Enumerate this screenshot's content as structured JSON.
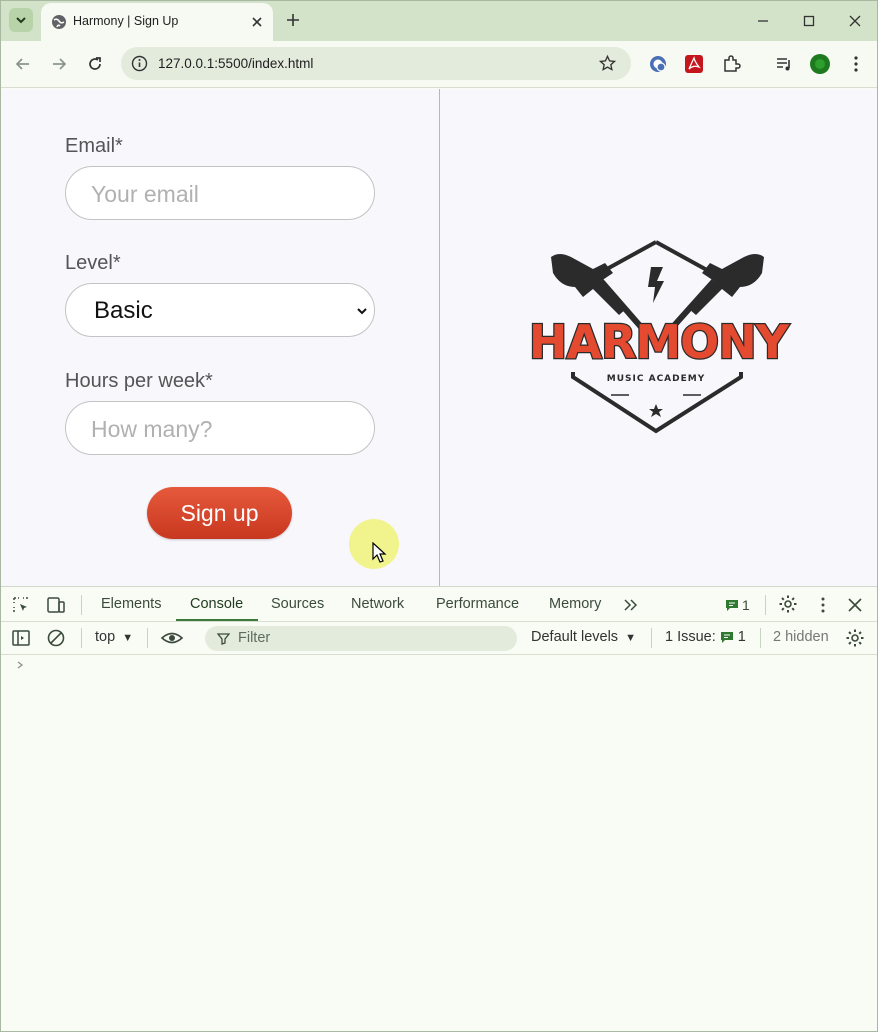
{
  "browser": {
    "tab": {
      "title": "Harmony | Sign Up"
    },
    "address_bar": {
      "url": "127.0.0.1:5500/index.html"
    }
  },
  "page": {
    "form": {
      "email": {
        "label": "Email*",
        "placeholder": "Your email"
      },
      "level": {
        "label": "Level*",
        "selected": "Basic"
      },
      "hours": {
        "label": "Hours per week*",
        "placeholder": "How many?"
      },
      "submit_label": "Sign up"
    },
    "logo": {
      "title": "HARMONY",
      "subtitle": "MUSIC ACADEMY"
    }
  },
  "devtools": {
    "tabs": [
      "Elements",
      "Console",
      "Sources",
      "Network",
      "Performance",
      "Memory"
    ],
    "active_tab": "Console",
    "message_count": "1",
    "console": {
      "context": "top",
      "filter_placeholder": "Filter",
      "levels": "Default levels",
      "issues_label": "1 Issue:",
      "issues_count": "1",
      "hidden": "2 hidden"
    }
  },
  "colors": {
    "accent": "#e44a2f",
    "tabstrip": "#d3e3c9",
    "devtools_active": "#3d7a3a",
    "cursor_highlight": "#f0f378"
  }
}
